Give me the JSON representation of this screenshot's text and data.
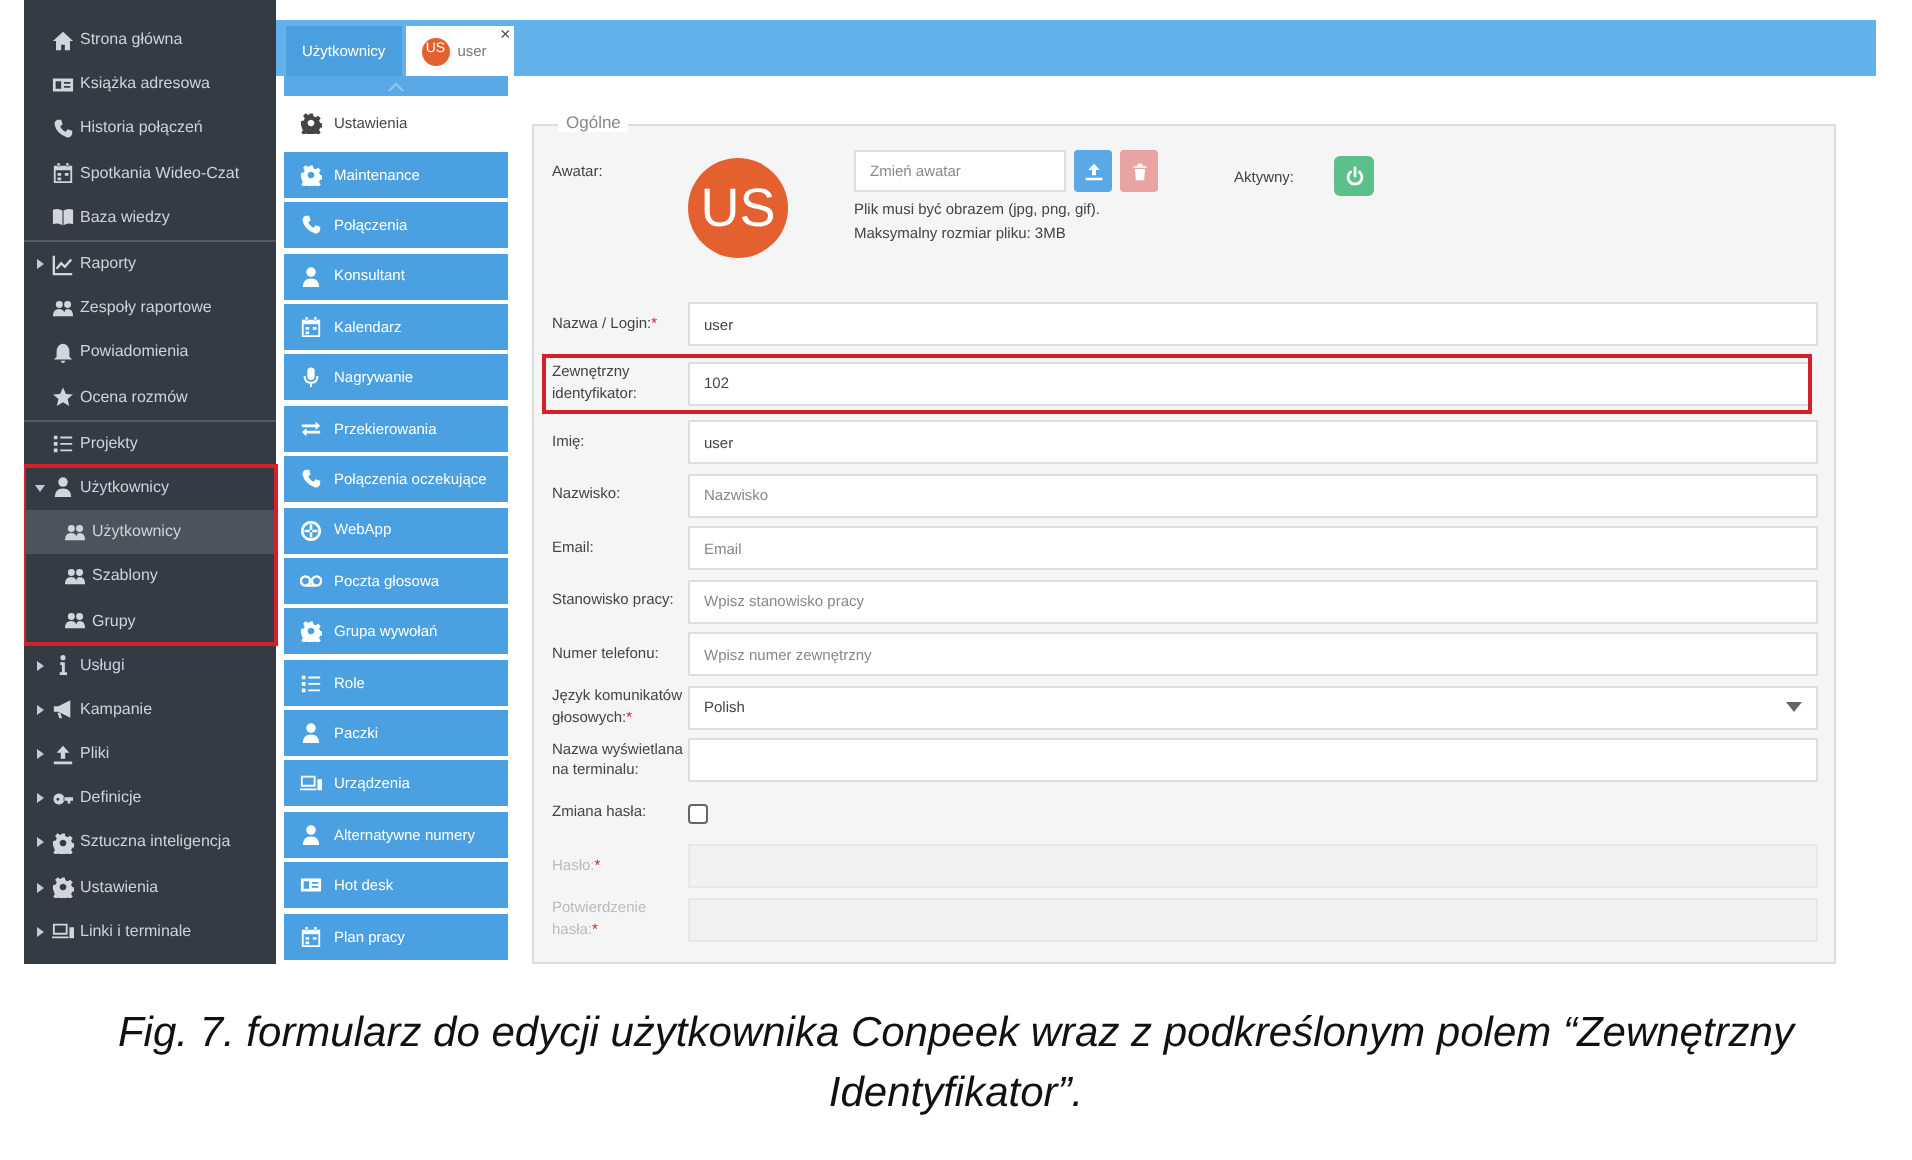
{
  "sidebar": {
    "items": [
      {
        "kind": "link",
        "label": "Strona główna",
        "selected": false,
        "highlighted": false,
        "separator_after": false
      },
      {
        "kind": "link",
        "label": "Książka adresowa",
        "selected": false,
        "highlighted": false,
        "separator_after": false
      },
      {
        "kind": "link",
        "label": "Historia połączeń",
        "selected": false,
        "highlighted": false,
        "separator_after": false
      },
      {
        "kind": "link",
        "label": "Spotkania Wideo-Czat",
        "selected": false,
        "highlighted": false,
        "separator_after": false
      },
      {
        "kind": "link",
        "label": "Baza wiedzy",
        "selected": false,
        "highlighted": false,
        "separator_after": true
      },
      {
        "kind": "group",
        "label": "Raporty",
        "selected": false,
        "highlighted": false,
        "separator_after": false,
        "expanded": false
      },
      {
        "kind": "link",
        "label": "Zespoły raportowe",
        "selected": false,
        "highlighted": false,
        "separator_after": false
      },
      {
        "kind": "link",
        "label": "Powiadomienia",
        "selected": false,
        "highlighted": false,
        "separator_after": false
      },
      {
        "kind": "link",
        "label": "Ocena rozmów",
        "selected": false,
        "highlighted": false,
        "separator_after": true
      },
      {
        "kind": "link",
        "label": "Projekty",
        "selected": false,
        "highlighted": false,
        "separator_after": false
      },
      {
        "kind": "group",
        "label": "Użytkownicy",
        "selected": false,
        "highlighted": true,
        "separator_after": false,
        "expanded": true,
        "children": [
          {
            "label": "Użytkownicy",
            "selected": true,
            "highlighted": false,
            "separator_after": false
          },
          {
            "label": "Szablony",
            "selected": false,
            "highlighted": false,
            "separator_after": false
          },
          {
            "label": "Grupy",
            "selected": false,
            "highlighted": false,
            "separator_after": false
          }
        ]
      },
      {
        "kind": "group",
        "label": "Usługi",
        "selected": false,
        "highlighted": false,
        "separator_after": false,
        "expanded": false
      },
      {
        "kind": "group",
        "label": "Kampanie",
        "selected": false,
        "highlighted": false,
        "separator_after": false,
        "expanded": false
      },
      {
        "kind": "group",
        "label": "Pliki",
        "selected": false,
        "highlighted": false,
        "separator_after": false,
        "expanded": false
      },
      {
        "kind": "group",
        "label": "Definicje",
        "selected": false,
        "highlighted": false,
        "separator_after": false,
        "expanded": false
      },
      {
        "kind": "group",
        "label": "Sztuczna inteligencja",
        "selected": false,
        "highlighted": false,
        "separator_after": false,
        "expanded": false
      },
      {
        "kind": "group",
        "label": "Ustawienia",
        "selected": false,
        "highlighted": false,
        "separator_after": false,
        "expanded": false
      },
      {
        "kind": "group",
        "label": "Linki i terminale",
        "selected": false,
        "highlighted": false,
        "separator_after": false,
        "expanded": false
      }
    ]
  },
  "tabs": [
    {
      "label": "Użytkownicy",
      "selected": false
    },
    {
      "label": "user",
      "initials": "US",
      "close": "×",
      "selected": true
    }
  ],
  "submenu": {
    "items": [
      {
        "label": "Ustawienia",
        "selected": true
      },
      {
        "label": "Maintenance",
        "selected": false
      },
      {
        "label": "Połączenia",
        "selected": false
      },
      {
        "label": "Konsultant",
        "selected": false
      },
      {
        "label": "Kalendarz",
        "selected": false
      },
      {
        "label": "Nagrywanie",
        "selected": false
      },
      {
        "label": "Przekierowania",
        "selected": false
      },
      {
        "label": "Połączenia oczekujące",
        "selected": false
      },
      {
        "label": "WebApp",
        "selected": false
      },
      {
        "label": "Poczta głosowa",
        "selected": false
      },
      {
        "label": "Grupa wywołań",
        "selected": false
      },
      {
        "label": "Role",
        "selected": false
      },
      {
        "label": "Paczki",
        "selected": false
      },
      {
        "label": "Urządzenia",
        "selected": false
      },
      {
        "label": "Alternatywne numery",
        "selected": false
      },
      {
        "label": "Hot desk",
        "selected": false
      },
      {
        "label": "Plan pracy",
        "selected": false
      }
    ]
  },
  "form": {
    "legend": "Ogólne",
    "avatar": {
      "label": "Awatar:",
      "initials": "US",
      "file_placeholder": "Zmień awatar",
      "help": [
        "Plik musi być obrazem (jpg, png, gif).",
        "Maksymalny rozmiar pliku: 3MB"
      ],
      "active_label": "Aktywny:",
      "active": true
    },
    "fields": [
      {
        "kind": "text",
        "label": "Nazwa / Login:",
        "mark": "*",
        "value": "user",
        "highlighted": false,
        "disabled": false
      },
      {
        "kind": "text",
        "label": "Zewnętrzny identyfikator:",
        "value": "102",
        "highlighted": true,
        "disabled": false
      },
      {
        "kind": "text",
        "label": "Imię:",
        "value": "user",
        "highlighted": false,
        "disabled": false
      },
      {
        "kind": "text",
        "label": "Nazwisko:",
        "placeholder": "Nazwisko",
        "highlighted": false,
        "disabled": false
      },
      {
        "kind": "text",
        "label": "Email:",
        "placeholder": "Email",
        "highlighted": false,
        "disabled": false
      },
      {
        "kind": "text",
        "label": "Stanowisko pracy:",
        "placeholder": "Wpisz stanowisko pracy",
        "highlighted": false,
        "disabled": false
      },
      {
        "kind": "text",
        "label": "Numer telefonu:",
        "placeholder": "Wpisz numer zewnętrzny",
        "highlighted": false,
        "disabled": false
      },
      {
        "kind": "select",
        "label": "Język komunikatów głosowych:",
        "mark": "*",
        "value": "Polish",
        "highlighted": false,
        "disabled": false
      },
      {
        "kind": "text",
        "label": "Nazwa wyświetlana na terminalu:",
        "highlighted": false,
        "disabled": false
      },
      {
        "kind": "checkbox",
        "label": "Zmiana hasła:",
        "checked": false,
        "highlighted": false,
        "disabled": false
      },
      {
        "kind": "password",
        "label": "Hasło:",
        "mark": "*",
        "highlighted": false,
        "disabled": true
      },
      {
        "kind": "password",
        "label": "Potwierdzenie hasła:",
        "mark": "*",
        "highlighted": false,
        "disabled": true
      }
    ]
  },
  "caption": "Fig. 7. formularz do edycji użytkownika Conpeek wraz z podkreślonym polem “Zewnętrzny Identyfikator”."
}
